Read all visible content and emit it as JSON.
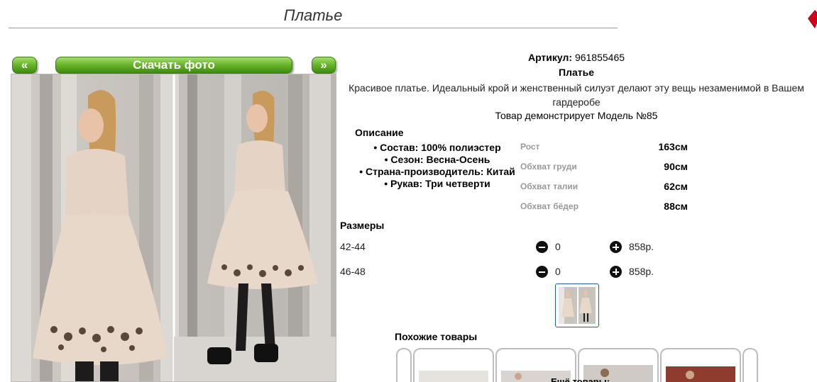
{
  "page": {
    "title": "Платье"
  },
  "gallery": {
    "prev_label": "«",
    "download_label": "Скачать фото",
    "next_label": "»"
  },
  "product": {
    "article_label": "Артикул:",
    "article_value": "961855465",
    "name": "Платье",
    "description": "Красивое платье. Идеальный крой и женственный силуэт делают эту вещь незаменимой в Вашем гардеробе",
    "model_text": "Товар демонстрирует Модель №85",
    "description_title": "Описание",
    "specs": [
      "Состав: 100% полиэстер",
      "Сезон: Весна-Осень",
      "Страна-производитель: Китай",
      "Рукав: Три четверти"
    ],
    "measurements": [
      {
        "label": "Рост",
        "value": "163см"
      },
      {
        "label": "Обхват груди",
        "value": "90см"
      },
      {
        "label": "Обхват талии",
        "value": "62см"
      },
      {
        "label": "Обхват бёдер",
        "value": "88см"
      }
    ]
  },
  "sizes": {
    "title": "Размеры",
    "rows": [
      {
        "size": "42-44",
        "qty": "0",
        "price": "858р."
      },
      {
        "size": "46-48",
        "qty": "0",
        "price": "858р."
      }
    ]
  },
  "similar": {
    "title": "Похожие товары",
    "more_label": "Ещё товары:"
  },
  "colors": {
    "button_green": "#5aa31e",
    "thumb_border": "#245a9c",
    "accent_red": "#d0021b"
  }
}
